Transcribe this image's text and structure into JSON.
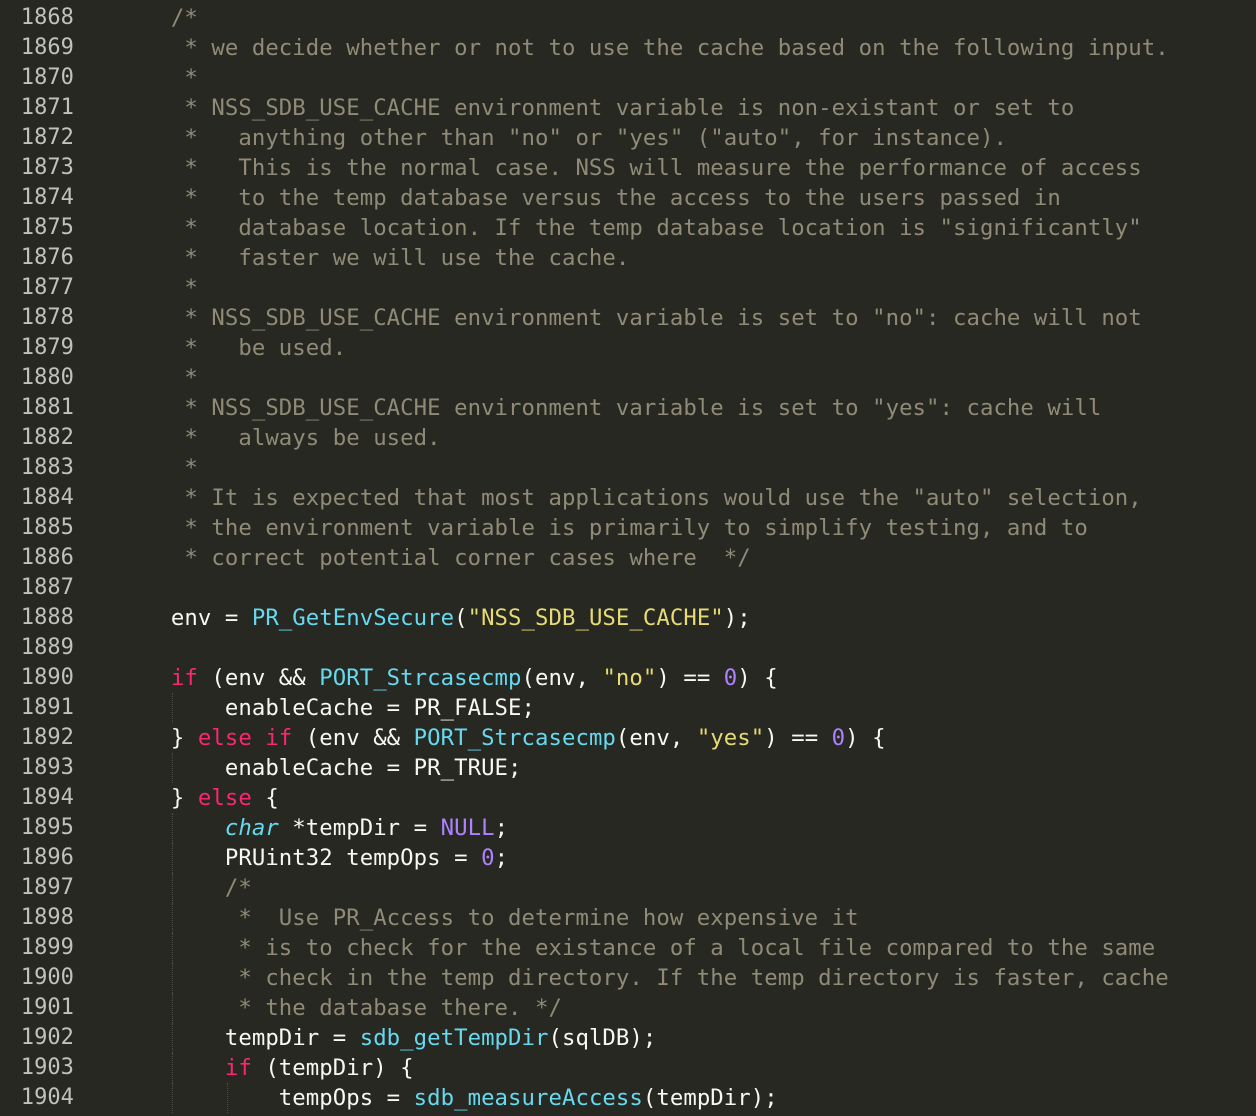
{
  "editor": {
    "theme": "Monokai",
    "colors": {
      "background": "#272822",
      "foreground": "#f8f8f2",
      "comment": "#8f8b77",
      "keyword": "#f92672",
      "function": "#66d9ef",
      "string": "#e6db74",
      "number": "#ae81ff",
      "gutter": "#c2c2bc"
    },
    "lines": [
      {
        "num": "1868",
        "tokens": [
          {
            "t": "    /*",
            "c": "c"
          }
        ]
      },
      {
        "num": "1869",
        "tokens": [
          {
            "t": "     * we decide whether or not to use the cache based on the following input.",
            "c": "c"
          }
        ]
      },
      {
        "num": "1870",
        "tokens": [
          {
            "t": "     *",
            "c": "c"
          }
        ]
      },
      {
        "num": "1871",
        "tokens": [
          {
            "t": "     * NSS_SDB_USE_CACHE environment variable is non-existant or set to",
            "c": "c"
          }
        ]
      },
      {
        "num": "1872",
        "tokens": [
          {
            "t": "     *   anything other than \"no\" or \"yes\" (\"auto\", for instance).",
            "c": "c"
          }
        ]
      },
      {
        "num": "1873",
        "tokens": [
          {
            "t": "     *   This is the normal case. NSS will measure the performance of access",
            "c": "c"
          }
        ]
      },
      {
        "num": "1874",
        "tokens": [
          {
            "t": "     *   to the temp database versus the access to the users passed in",
            "c": "c"
          }
        ]
      },
      {
        "num": "1875",
        "tokens": [
          {
            "t": "     *   database location. If the temp database location is \"significantly\"",
            "c": "c"
          }
        ]
      },
      {
        "num": "1876",
        "tokens": [
          {
            "t": "     *   faster we will use the cache.",
            "c": "c"
          }
        ]
      },
      {
        "num": "1877",
        "tokens": [
          {
            "t": "     *",
            "c": "c"
          }
        ]
      },
      {
        "num": "1878",
        "tokens": [
          {
            "t": "     * NSS_SDB_USE_CACHE environment variable is set to \"no\": cache will not",
            "c": "c"
          }
        ]
      },
      {
        "num": "1879",
        "tokens": [
          {
            "t": "     *   be used.",
            "c": "c"
          }
        ]
      },
      {
        "num": "1880",
        "tokens": [
          {
            "t": "     *",
            "c": "c"
          }
        ]
      },
      {
        "num": "1881",
        "tokens": [
          {
            "t": "     * NSS_SDB_USE_CACHE environment variable is set to \"yes\": cache will",
            "c": "c"
          }
        ]
      },
      {
        "num": "1882",
        "tokens": [
          {
            "t": "     *   always be used.",
            "c": "c"
          }
        ]
      },
      {
        "num": "1883",
        "tokens": [
          {
            "t": "     *",
            "c": "c"
          }
        ]
      },
      {
        "num": "1884",
        "tokens": [
          {
            "t": "     * It is expected that most applications would use the \"auto\" selection,",
            "c": "c"
          }
        ]
      },
      {
        "num": "1885",
        "tokens": [
          {
            "t": "     * the environment variable is primarily to simplify testing, and to",
            "c": "c"
          }
        ]
      },
      {
        "num": "1886",
        "tokens": [
          {
            "t": "     * correct potential corner cases where  */",
            "c": "c"
          }
        ]
      },
      {
        "num": "1887",
        "tokens": []
      },
      {
        "num": "1888",
        "tokens": [
          {
            "t": "    env = ",
            "c": "p"
          },
          {
            "t": "PR_GetEnvSecure",
            "c": "f"
          },
          {
            "t": "(",
            "c": "p"
          },
          {
            "t": "\"NSS_SDB_USE_CACHE\"",
            "c": "s"
          },
          {
            "t": ");",
            "c": "p"
          }
        ]
      },
      {
        "num": "1889",
        "tokens": []
      },
      {
        "num": "1890",
        "tokens": [
          {
            "t": "    ",
            "c": "p"
          },
          {
            "t": "if",
            "c": "k"
          },
          {
            "t": " (env && ",
            "c": "p"
          },
          {
            "t": "PORT_Strcasecmp",
            "c": "f"
          },
          {
            "t": "(env, ",
            "c": "p"
          },
          {
            "t": "\"no\"",
            "c": "s"
          },
          {
            "t": ") == ",
            "c": "p"
          },
          {
            "t": "0",
            "c": "n"
          },
          {
            "t": ") {",
            "c": "p"
          }
        ]
      },
      {
        "num": "1891",
        "tokens": [
          {
            "t": "        enableCache = PR_FALSE;",
            "c": "p"
          }
        ]
      },
      {
        "num": "1892",
        "tokens": [
          {
            "t": "    } ",
            "c": "p"
          },
          {
            "t": "else if",
            "c": "k"
          },
          {
            "t": " (env && ",
            "c": "p"
          },
          {
            "t": "PORT_Strcasecmp",
            "c": "f"
          },
          {
            "t": "(env, ",
            "c": "p"
          },
          {
            "t": "\"yes\"",
            "c": "s"
          },
          {
            "t": ") == ",
            "c": "p"
          },
          {
            "t": "0",
            "c": "n"
          },
          {
            "t": ") {",
            "c": "p"
          }
        ]
      },
      {
        "num": "1893",
        "tokens": [
          {
            "t": "        enableCache = PR_TRUE;",
            "c": "p"
          }
        ]
      },
      {
        "num": "1894",
        "tokens": [
          {
            "t": "    } ",
            "c": "p"
          },
          {
            "t": "else",
            "c": "k"
          },
          {
            "t": " {",
            "c": "p"
          }
        ]
      },
      {
        "num": "1895",
        "tokens": [
          {
            "t": "        ",
            "c": "p"
          },
          {
            "t": "char",
            "c": "i"
          },
          {
            "t": " *tempDir = ",
            "c": "p"
          },
          {
            "t": "NULL",
            "c": "n"
          },
          {
            "t": ";",
            "c": "p"
          }
        ]
      },
      {
        "num": "1896",
        "tokens": [
          {
            "t": "        PRUint32 tempOps = ",
            "c": "p"
          },
          {
            "t": "0",
            "c": "n"
          },
          {
            "t": ";",
            "c": "p"
          }
        ]
      },
      {
        "num": "1897",
        "tokens": [
          {
            "t": "        /*",
            "c": "c"
          }
        ]
      },
      {
        "num": "1898",
        "tokens": [
          {
            "t": "         *  Use PR_Access to determine how expensive it",
            "c": "c"
          }
        ]
      },
      {
        "num": "1899",
        "tokens": [
          {
            "t": "         * is to check for the existance of a local file compared to the same",
            "c": "c"
          }
        ]
      },
      {
        "num": "1900",
        "tokens": [
          {
            "t": "         * check in the temp directory. If the temp directory is faster, cache",
            "c": "c"
          }
        ]
      },
      {
        "num": "1901",
        "tokens": [
          {
            "t": "         * the database there. */",
            "c": "c"
          }
        ]
      },
      {
        "num": "1902",
        "tokens": [
          {
            "t": "        tempDir = ",
            "c": "p"
          },
          {
            "t": "sdb_getTempDir",
            "c": "f"
          },
          {
            "t": "(sqlDB);",
            "c": "p"
          }
        ]
      },
      {
        "num": "1903",
        "tokens": [
          {
            "t": "        ",
            "c": "p"
          },
          {
            "t": "if",
            "c": "k"
          },
          {
            "t": " (tempDir) {",
            "c": "p"
          }
        ]
      },
      {
        "num": "1904",
        "tokens": [
          {
            "t": "            tempOps = ",
            "c": "p"
          },
          {
            "t": "sdb_measureAccess",
            "c": "f"
          },
          {
            "t": "(tempDir);",
            "c": "p"
          }
        ]
      }
    ]
  }
}
